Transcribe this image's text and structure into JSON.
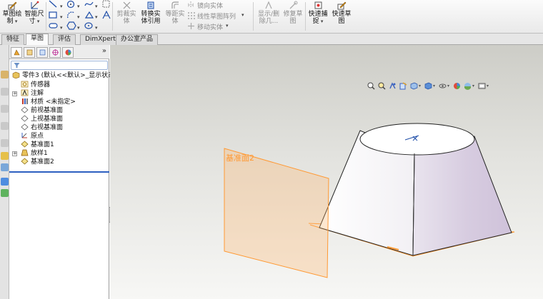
{
  "toolbar": {
    "sketch_label_1": "草图绘",
    "sketch_label_2": "制",
    "smart_dim_label_1": "智能尺",
    "smart_dim_label_2": "寸",
    "trim_label_1": "剪裁实",
    "trim_label_2": "体",
    "convert_label_1": "转换实",
    "convert_label_2": "体引用",
    "offset_label_1": "等距实",
    "offset_label_2": "体",
    "mirror_label": "镜向实体",
    "linear_pattern_label": "线性草图阵列",
    "move_label": "移动实体",
    "display_label_1": "显示/删",
    "display_label_2": "除几...",
    "repair_label_1": "修复草",
    "repair_label_2": "图",
    "quick_snap_label_1": "快速捕",
    "quick_snap_label_2": "捉",
    "rapid_sketch_label_1": "快速草",
    "rapid_sketch_label_2": "图"
  },
  "tabs": [
    "特征",
    "草图",
    "评估",
    "DimXpert",
    "办公室产品"
  ],
  "active_tab": "草图",
  "feature_tree": {
    "part": "零件3 (默认<<默认>_显示状态",
    "items": [
      {
        "label": "传感器",
        "icon": "sensor-icon",
        "expandable": false
      },
      {
        "label": "注解",
        "icon": "annotation-icon",
        "expandable": true
      },
      {
        "label": "材质 <未指定>",
        "icon": "material-icon",
        "expandable": false
      },
      {
        "label": "前视基准面",
        "icon": "plane-icon",
        "expandable": false
      },
      {
        "label": "上视基准面",
        "icon": "plane-icon",
        "expandable": false
      },
      {
        "label": "右视基准面",
        "icon": "plane-icon",
        "expandable": false
      },
      {
        "label": "原点",
        "icon": "origin-icon",
        "expandable": false
      },
      {
        "label": "基准面1",
        "icon": "plane-icon",
        "expandable": false
      },
      {
        "label": "放样1",
        "icon": "loft-icon",
        "expandable": true
      },
      {
        "label": "基准面2",
        "icon": "plane-icon",
        "expandable": false
      }
    ]
  },
  "viewport": {
    "plane_label": "基准面2",
    "plane_color": "#ff9933",
    "body_color": "#d8cfe0"
  }
}
